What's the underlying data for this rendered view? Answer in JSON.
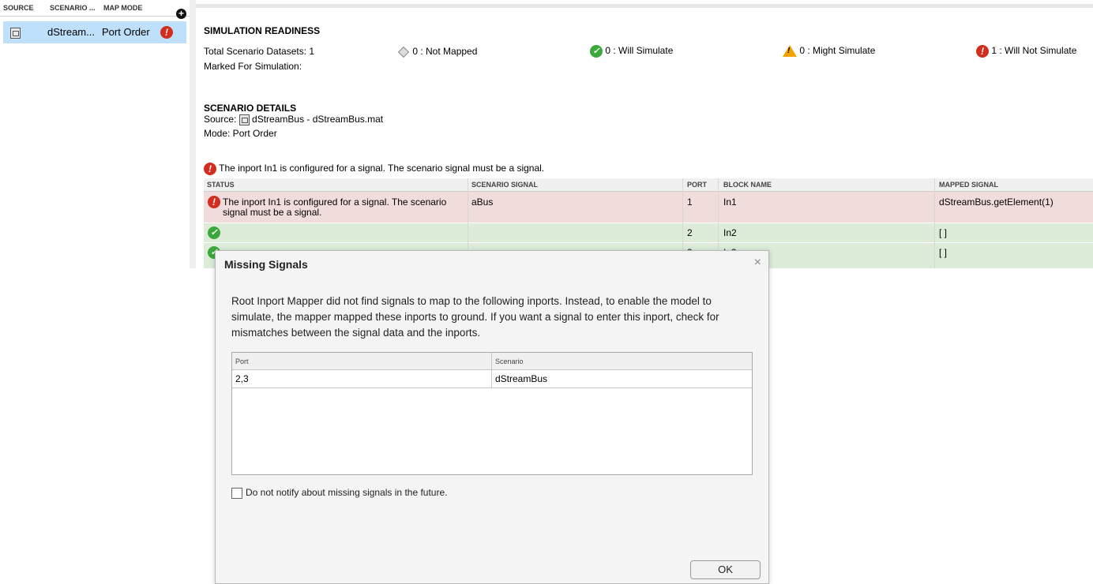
{
  "left_panel": {
    "columns": [
      "SOURCE",
      "SCENARIO ...",
      "MAP MODE"
    ],
    "row": {
      "icon": "mat-file-icon",
      "scenario": "dStream...",
      "map_mode": "Port Order",
      "status_icon": "error-icon"
    }
  },
  "readiness": {
    "heading": "SIMULATION READINESS",
    "total": "Total Scenario Datasets: 1",
    "marked": "Marked For Simulation:",
    "not_mapped": "0 : Not Mapped",
    "will_simulate": "0 : Will Simulate",
    "might_simulate": "0 : Might Simulate",
    "will_not_simulate": "1 : Will Not Simulate"
  },
  "details": {
    "heading": "SCENARIO DETAILS",
    "source_label": "Source:",
    "source_value": "dStreamBus - dStreamBus.mat",
    "mode": "Mode: Port Order"
  },
  "error_banner": "The inport In1 is configured for a signal. The scenario signal must be a signal.",
  "table": {
    "headers": [
      "STATUS",
      "SCENARIO SIGNAL",
      "PORT",
      "BLOCK NAME",
      "MAPPED SIGNAL"
    ],
    "rows": [
      {
        "status": "error",
        "status_text_1": "The inport In1 is configured for a signal. The scenario",
        "status_text_2": "signal must be a signal.",
        "signal": "aBus",
        "port": "1",
        "block": "In1",
        "mapped": "dStreamBus.getElement(1)"
      },
      {
        "status": "ok",
        "status_text_1": "",
        "status_text_2": "",
        "signal": "",
        "port": "2",
        "block": "In2",
        "mapped": "[ ]"
      },
      {
        "status": "ok",
        "status_text_1": "",
        "status_text_2": "",
        "signal": "",
        "port": "3",
        "block": "In3",
        "mapped": "[ ]"
      }
    ]
  },
  "dialog": {
    "title": "Missing Signals",
    "close": "×",
    "message_line1": "Root Inport Mapper did not find signals to map to the following inports. Instead, to enable the model to",
    "message_line2": "simulate, the mapper mapped these inports to ground. If you want a signal to enter this inport, check for",
    "message_line3": "mismatches between the signal data and the inports.",
    "grid_headers": [
      "Port",
      "Scenario"
    ],
    "grid_row": [
      "2,3",
      "dStreamBus"
    ],
    "checkbox_label": "Do not notify about missing signals in the future.",
    "checkbox_checked": false,
    "ok_label": "OK"
  },
  "colors": {
    "error_row": "#f1dcdc",
    "ok_row": "#dcecd9",
    "selected_row": "#bfe0fb",
    "error": "#d22d1e",
    "ok": "#3ba83b",
    "warning": "#f2a300"
  }
}
